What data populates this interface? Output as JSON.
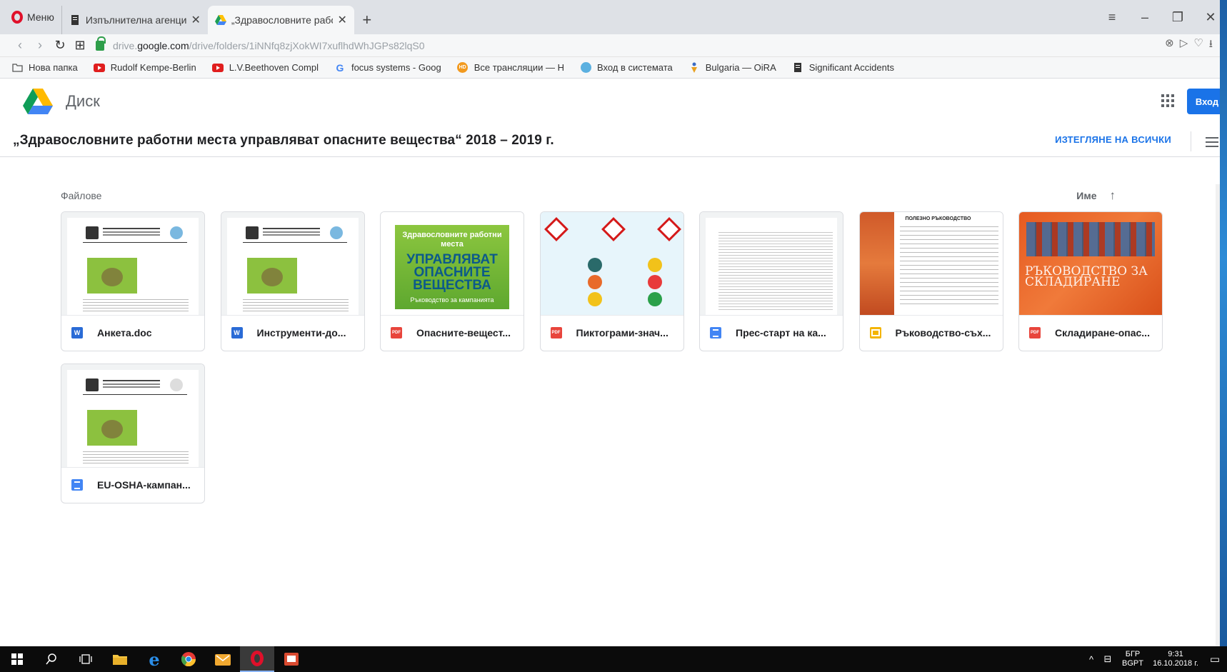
{
  "browser": {
    "menu_label": "Меню",
    "tabs": [
      {
        "title": "Изпълнителна агенция „Г",
        "active": false
      },
      {
        "title": "„Здравословните работни",
        "active": true
      }
    ],
    "address": {
      "domain_prefix": "drive.",
      "domain": "google.com",
      "path": "/drive/folders/1iNNfq8zjXokWI7xuflhdWhJGPs82lqS0"
    },
    "bookmarks": [
      {
        "label": "Нова папка",
        "icon": "folder-icon"
      },
      {
        "label": "Rudolf Kempe-Berlin",
        "icon": "youtube-icon"
      },
      {
        "label": "L.V.Beethoven Compl",
        "icon": "youtube-icon"
      },
      {
        "label": "focus systems - Goog",
        "icon": "google-icon"
      },
      {
        "label": "Все трансляции — H",
        "icon": "hd-icon"
      },
      {
        "label": "Вход в системата",
        "icon": "globe-icon"
      },
      {
        "label": "Bulgaria — OiRA",
        "icon": "oira-icon"
      },
      {
        "label": "Significant Accidents",
        "icon": "document-icon"
      }
    ]
  },
  "drive": {
    "app_name": "Диск",
    "signin_label": "Вход",
    "folder_title": "„Здравословните работни места управляват опасните вещества“ 2018 – 2019 г.",
    "download_all_label": "ИЗТЕГЛЯНЕ НА ВСИЧКИ",
    "section_label": "Файлове",
    "sort_label": "Име",
    "files": [
      {
        "name": "Анкета.doc",
        "type": "word"
      },
      {
        "name": "Инструменти-до...",
        "type": "word"
      },
      {
        "name": "Опасните-вещест...",
        "type": "pdf"
      },
      {
        "name": "Пиктограми-знач...",
        "type": "pdf"
      },
      {
        "name": "Прес-старт на ка...",
        "type": "doc"
      },
      {
        "name": "Ръководство-съх...",
        "type": "slides"
      },
      {
        "name": "Складиране-опас...",
        "type": "pdf"
      },
      {
        "name": "EU-OSHA-кампан...",
        "type": "doc"
      }
    ],
    "thumbnails": {
      "green_cover_line1": "Здравословните работни места",
      "green_cover_line2": "УПРАВЛЯВАТ ОПАСНИТЕ ВЕЩЕСТВА",
      "green_cover_line3": "Ръководство за кампанията",
      "guide_title": "ПОЛЕЗНО РЪКОВОДСТВО",
      "orange_title": "РЪКОВОДСТВО ЗА СКЛАДИРАНЕ"
    }
  },
  "taskbar": {
    "lang_top": "БГР",
    "lang_bottom": "BGPT",
    "time": "9:31",
    "date": "16.10.2018 г."
  },
  "colors": {
    "accent": "#1a73e8",
    "opera_red": "#e0102a",
    "word_blue": "#2a6bd6",
    "pdf_red": "#e8453c",
    "slides_yellow": "#f4b400"
  }
}
